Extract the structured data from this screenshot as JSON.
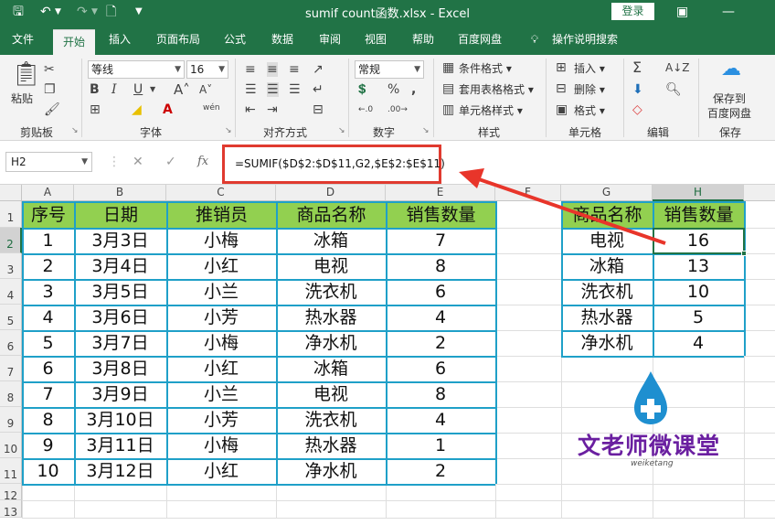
{
  "titlebar": {
    "title": "sumif count函数.xlsx  -  Excel",
    "login_label": "登录"
  },
  "menu": {
    "tabs": [
      "文件",
      "开始",
      "插入",
      "页面布局",
      "公式",
      "数据",
      "审阅",
      "视图",
      "帮助",
      "百度网盘"
    ],
    "active_tab": "开始",
    "tell_me": "操作说明搜索"
  },
  "ribbon": {
    "clipboard": {
      "paste": "粘贴",
      "group": "剪贴板"
    },
    "font": {
      "name": "等线",
      "size": "16",
      "group": "字体",
      "bold": "B",
      "italic": "I",
      "underline": "U",
      "wen": "wén"
    },
    "alignment": {
      "group": "对齐方式"
    },
    "number": {
      "format": "常规",
      "group": "数字",
      "percent": "%"
    },
    "styles": {
      "conditional": "条件格式",
      "table": "套用表格格式",
      "cell": "单元格样式",
      "group": "样式"
    },
    "cells": {
      "insert": "插入",
      "delete": "删除",
      "format": "格式",
      "group": "单元格"
    },
    "editing": {
      "group": "编辑"
    },
    "save": {
      "line1": "保存到",
      "line2": "百度网盘",
      "group": "保存"
    }
  },
  "formula_bar": {
    "name_box": "H2",
    "formula": "=SUMIF($D$2:$D$11,G2,$E$2:$E$11)",
    "fx": "fx"
  },
  "sheet": {
    "columns": [
      "A",
      "B",
      "C",
      "D",
      "E",
      "F",
      "G",
      "H"
    ],
    "rows": [
      "1",
      "2",
      "3",
      "4",
      "5",
      "6",
      "7",
      "8",
      "9",
      "10",
      "11",
      "12",
      "13"
    ],
    "selected_cell": "H2",
    "table1": {
      "headers": [
        "序号",
        "日期",
        "推销员",
        "商品名称",
        "销售数量"
      ],
      "rows": [
        [
          "1",
          "3月3日",
          "小梅",
          "冰箱",
          "7"
        ],
        [
          "2",
          "3月4日",
          "小红",
          "电视",
          "8"
        ],
        [
          "3",
          "3月5日",
          "小兰",
          "洗衣机",
          "6"
        ],
        [
          "4",
          "3月6日",
          "小芳",
          "热水器",
          "4"
        ],
        [
          "5",
          "3月7日",
          "小梅",
          "净水机",
          "2"
        ],
        [
          "6",
          "3月8日",
          "小红",
          "冰箱",
          "6"
        ],
        [
          "7",
          "3月9日",
          "小兰",
          "电视",
          "8"
        ],
        [
          "8",
          "3月10日",
          "小芳",
          "洗衣机",
          "4"
        ],
        [
          "9",
          "3月11日",
          "小梅",
          "热水器",
          "1"
        ],
        [
          "10",
          "3月12日",
          "小红",
          "净水机",
          "2"
        ]
      ]
    },
    "table2": {
      "headers": [
        "商品名称",
        "销售数量"
      ],
      "rows": [
        [
          "电视",
          "16"
        ],
        [
          "冰箱",
          "13"
        ],
        [
          "洗衣机",
          "10"
        ],
        [
          "热水器",
          "5"
        ],
        [
          "净水机",
          "4"
        ]
      ]
    }
  },
  "watermark": {
    "brand": "文老师微课堂",
    "sub": "weiketang"
  },
  "colors": {
    "excel_green": "#217346",
    "header_fill": "#92d050",
    "table_border": "#1fa0c8",
    "highlight_red": "#e03a2f",
    "logo_purple": "#6a1fa0",
    "logo_blue": "#1e8fd0"
  }
}
